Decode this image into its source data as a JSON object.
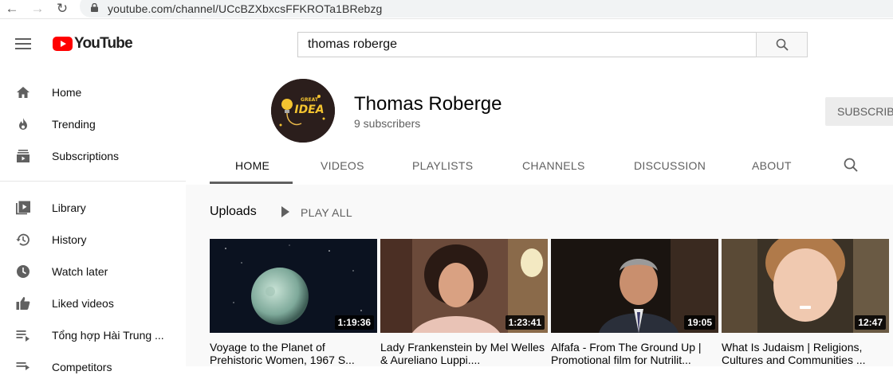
{
  "browser": {
    "url": "youtube.com/channel/UCcBZXbxcsFFKROTa1BRebzg"
  },
  "masthead": {
    "logo_text": "YouTube",
    "search_value": "thomas roberge",
    "search_icon": "search-icon"
  },
  "sidebar": {
    "items": [
      {
        "label": "Home",
        "icon": "home-icon"
      },
      {
        "label": "Trending",
        "icon": "flame-icon"
      },
      {
        "label": "Subscriptions",
        "icon": "subscriptions-icon"
      },
      {
        "label": "Library",
        "icon": "library-icon"
      },
      {
        "label": "History",
        "icon": "history-icon"
      },
      {
        "label": "Watch later",
        "icon": "clock-icon"
      },
      {
        "label": "Liked videos",
        "icon": "thumbs-up-icon"
      },
      {
        "label": "Tổng hợp Hài Trung ...",
        "icon": "playlist-icon"
      },
      {
        "label": "Competitors",
        "icon": "playlist-icon"
      }
    ]
  },
  "channel": {
    "name": "Thomas Roberge",
    "subscribers": "9 subscribers",
    "subscribe_label": "SUBSCRIBE",
    "avatar_text_top": "GREAT",
    "avatar_text_main": "IDEA"
  },
  "tabs": [
    "HOME",
    "VIDEOS",
    "PLAYLISTS",
    "CHANNELS",
    "DISCUSSION",
    "ABOUT"
  ],
  "active_tab": "HOME",
  "uploads": {
    "heading": "Uploads",
    "play_all": "PLAY ALL"
  },
  "videos": [
    {
      "title": "Voyage to the Planet of Prehistoric Women, 1967 S...",
      "duration": "1:19:36"
    },
    {
      "title": "Lady Frankenstein by Mel Welles & Aureliano Luppi....",
      "duration": "1:23:41"
    },
    {
      "title": "Alfafa - From The Ground Up | Promotional film for Nutrilit...",
      "duration": "19:05"
    },
    {
      "title": "What Is Judaism | Religions, Cultures and Communities ...",
      "duration": "12:47"
    }
  ],
  "colors": {
    "brand_red": "#ff0000",
    "main_bg": "#f9f9f9",
    "text_secondary": "#606060"
  }
}
